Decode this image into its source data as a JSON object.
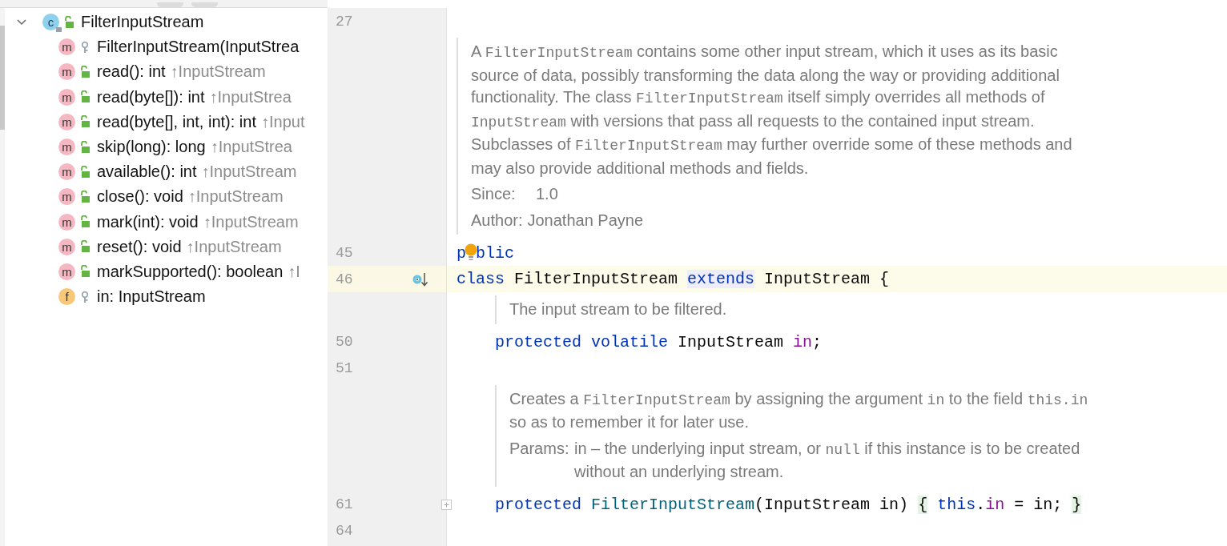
{
  "structure": {
    "label": "FilterInputStream",
    "letter": "c",
    "kind": "class",
    "public": true,
    "expanded": true,
    "children": [
      {
        "kind": "method",
        "letter": "m",
        "public": false,
        "label": "FilterInputStream(InputStrea"
      },
      {
        "kind": "method",
        "letter": "m",
        "public": true,
        "label": "read(): int",
        "origin": "↑InputStream"
      },
      {
        "kind": "method",
        "letter": "m",
        "public": true,
        "label": "read(byte[]): int",
        "origin": "↑InputStrea"
      },
      {
        "kind": "method",
        "letter": "m",
        "public": true,
        "label": "read(byte[], int, int): int",
        "origin": "↑Input"
      },
      {
        "kind": "method",
        "letter": "m",
        "public": true,
        "label": "skip(long): long",
        "origin": "↑InputStrea"
      },
      {
        "kind": "method",
        "letter": "m",
        "public": true,
        "label": "available(): int",
        "origin": "↑InputStream"
      },
      {
        "kind": "method",
        "letter": "m",
        "public": true,
        "label": "close(): void",
        "origin": "↑InputStream"
      },
      {
        "kind": "method",
        "letter": "m",
        "public": true,
        "label": "mark(int): void",
        "origin": "↑InputStream"
      },
      {
        "kind": "method",
        "letter": "m",
        "public": true,
        "label": "reset(): void",
        "origin": "↑InputStream"
      },
      {
        "kind": "method",
        "letter": "m",
        "public": true,
        "label": "markSupported(): boolean",
        "origin": "↑I"
      },
      {
        "kind": "field",
        "letter": "f",
        "public": false,
        "label": "in: InputStream"
      }
    ]
  },
  "editor": {
    "lines": [
      {
        "kind": "code",
        "number": "27",
        "current": false
      },
      {
        "kind": "doc",
        "lines": [
          [
            {
              "kind": "text",
              "text": "A "
            },
            {
              "kind": "code",
              "text": "FilterInputStream"
            },
            {
              "kind": "text",
              "text": " contains some other input stream, which it uses as its basic"
            }
          ],
          [
            {
              "kind": "text",
              "text": "source of data, possibly transforming the data along the way or providing additional"
            }
          ],
          [
            {
              "kind": "text",
              "text": "functionality. The class "
            },
            {
              "kind": "code",
              "text": "FilterInputStream"
            },
            {
              "kind": "text",
              "text": " itself simply overrides all methods of"
            }
          ],
          [
            {
              "kind": "code",
              "text": "InputStream"
            },
            {
              "kind": "text",
              "text": " with versions that pass all requests to the contained input stream."
            }
          ],
          [
            {
              "kind": "text",
              "text": "Subclasses of "
            },
            {
              "kind": "code",
              "text": "FilterInputStream"
            },
            {
              "kind": "text",
              "text": " may further override some of these methods and"
            }
          ],
          [
            {
              "kind": "text",
              "text": "may also provide additional methods and fields."
            }
          ]
        ],
        "tags": [
          {
            "label": "Since:",
            "kind": "column",
            "lines": [
              [
                {
                  "kind": "text",
                  "text": "1.0"
                }
              ]
            ]
          },
          {
            "label": "Author:",
            "kind": "inline",
            "lines": [
              [
                {
                  "kind": "text",
                  "text": "Jonathan Payne"
                }
              ]
            ]
          }
        ]
      },
      {
        "kind": "code",
        "number": "45",
        "current": false,
        "tokens": [
          {
            "kind": "keyword",
            "text": "p"
          },
          {
            "kind": "bulb"
          },
          {
            "kind": "keyword",
            "text": "blic"
          }
        ]
      },
      {
        "kind": "code",
        "number": "46",
        "current": true,
        "implemented": true,
        "tokens": [
          {
            "kind": "keyword",
            "text": "class"
          },
          {
            "kind": "plain",
            "text": " FilterInputStream "
          },
          {
            "kind": "keyword-highlight",
            "text": "extends"
          },
          {
            "kind": "plain",
            "text": " InputStream {"
          }
        ],
        "children": [
          {
            "kind": "doc",
            "lines": [
              [
                {
                  "kind": "text",
                  "text": "The input stream to be filtered."
                }
              ]
            ]
          },
          {
            "kind": "code",
            "number": "50",
            "current": false,
            "tokens": [
              {
                "kind": "keyword",
                "text": "protected volatile"
              },
              {
                "kind": "plain",
                "text": " InputStream "
              },
              {
                "kind": "field",
                "text": "in"
              },
              {
                "kind": "plain",
                "text": ";"
              }
            ]
          },
          {
            "kind": "code",
            "number": "51",
            "current": false
          },
          {
            "kind": "doc",
            "lines": [
              [
                {
                  "kind": "text",
                  "text": "Creates a "
                },
                {
                  "kind": "code",
                  "text": "FilterInputStream"
                },
                {
                  "kind": "text",
                  "text": " by assigning the argument "
                },
                {
                  "kind": "code",
                  "text": "in"
                },
                {
                  "kind": "text",
                  "text": " to the field "
                },
                {
                  "kind": "code",
                  "text": "this.in"
                }
              ],
              [
                {
                  "kind": "text",
                  "text": "so as to remember it for later use."
                }
              ]
            ],
            "tags": [
              {
                "label": "Params:",
                "kind": "column",
                "lines": [
                  [
                    {
                      "kind": "text",
                      "text": "in – the underlying input stream, or "
                    },
                    {
                      "kind": "code",
                      "text": "null"
                    },
                    {
                      "kind": "text",
                      "text": " if this instance is to be created"
                    }
                  ],
                  [
                    {
                      "kind": "text",
                      "text": "without an underlying stream."
                    }
                  ]
                ]
              }
            ]
          },
          {
            "kind": "code",
            "number": "61",
            "current": false,
            "collapsible": true,
            "tokens": [
              {
                "kind": "keyword",
                "text": "protected "
              },
              {
                "kind": "method",
                "text": "FilterInputStream"
              },
              {
                "kind": "plain",
                "text": "(InputStream in) "
              },
              {
                "kind": "brace-highlight",
                "text": "{"
              },
              {
                "kind": "keyword",
                "text": " this"
              },
              {
                "kind": "plain",
                "text": "."
              },
              {
                "kind": "field",
                "text": "in"
              },
              {
                "kind": "plain",
                "text": " = in; "
              },
              {
                "kind": "brace-highlight",
                "text": "}"
              }
            ]
          },
          {
            "kind": "code",
            "number": "64",
            "current": false
          }
        ]
      }
    ]
  }
}
